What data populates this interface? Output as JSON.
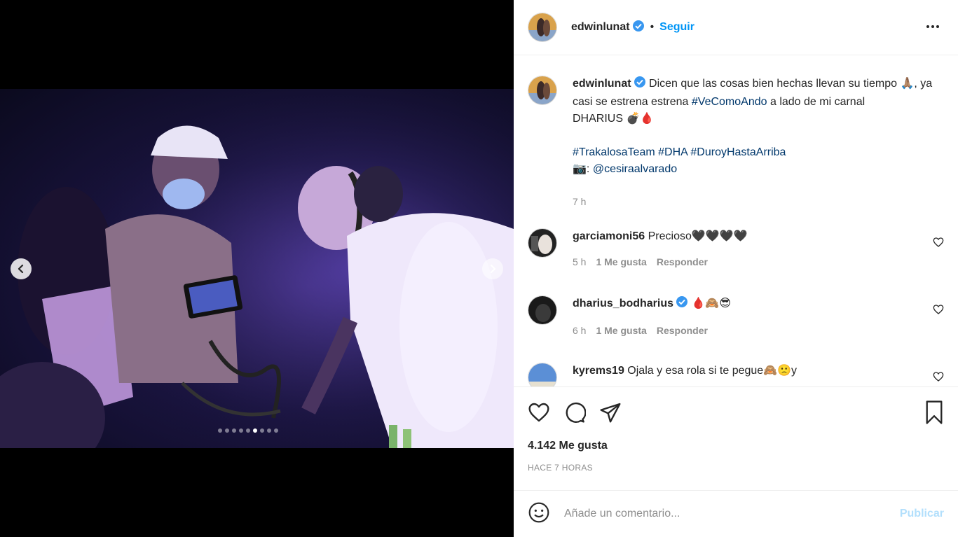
{
  "post": {
    "username": "edwinlunat",
    "follow_label": "Seguir",
    "separator": "•"
  },
  "media": {
    "dots_count": 9,
    "active_dot": 5
  },
  "caption": {
    "username": "edwinlunat",
    "text_1": "Dicen que las cosas bien hechas llevan su tiempo 🙏🏽,",
    "text_2": "ya casi se estrena estrena",
    "hashtag_1": "#VeComoAndo",
    "text_3": "a lado de mi carnal",
    "text_4": "DHARIUS 💣🩸",
    "hashtags": [
      "#TrakalosaTeam",
      "#DHA",
      "#DuroyHastaArriba"
    ],
    "photo_credit_prefix": "📷:",
    "photo_credit": "@cesiraalvarado",
    "time": "7 h"
  },
  "comments": [
    {
      "username": "garciamoni56",
      "text": "Precioso🖤🖤🖤🖤",
      "time": "5 h",
      "likes": "1 Me gusta",
      "reply": "Responder",
      "verified": false
    },
    {
      "username": "dharius_bodharius",
      "text": "🩸🙈😎",
      "time": "6 h",
      "likes": "1 Me gusta",
      "reply": "Responder",
      "verified": true
    },
    {
      "username": "kyrems19",
      "text": "Ojala y esa rola si te pegue🙈🙁y",
      "verified": false
    }
  ],
  "footer": {
    "likes": "4.142 Me gusta",
    "posted": "HACE 7 HORAS",
    "comment_placeholder": "Añade un comentario...",
    "publish_label": "Publicar"
  },
  "colors": {
    "link": "#00376b",
    "accent": "#0095f6",
    "publish_disabled": "#b2dffc",
    "verified": "#3897f0"
  }
}
